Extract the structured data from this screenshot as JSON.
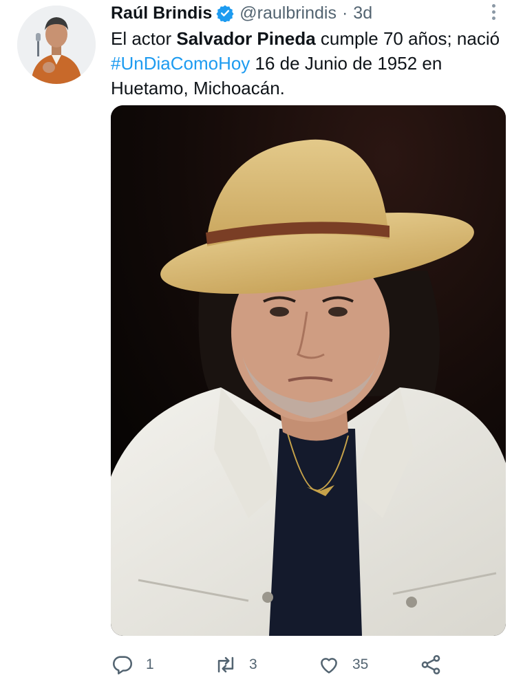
{
  "tweet": {
    "author": {
      "display_name": "Raúl Brindis",
      "handle": "@raulbrindis",
      "verified": true,
      "avatar_icon": "person-avatar"
    },
    "separator": "·",
    "timestamp": "3d",
    "text": {
      "part1": "El actor ",
      "bold_name": "Salvador Pineda",
      "part2": " cumple 70 años; nació ",
      "hashtag": "#UnDiaComoHoy",
      "part3": " 16 de Junio de 1952 en Huetamo, Michoacán."
    },
    "media": {
      "type": "photo"
    },
    "actions": {
      "reply": {
        "icon": "reply-icon",
        "count": "1"
      },
      "retweet": {
        "icon": "retweet-icon",
        "count": "3"
      },
      "like": {
        "icon": "heart-icon",
        "count": "35"
      },
      "share": {
        "icon": "share-icon"
      }
    }
  },
  "colors": {
    "text": "#0f1419",
    "secondary": "#536471",
    "link": "#1d9bf0",
    "verified": "#1d9bf0"
  }
}
